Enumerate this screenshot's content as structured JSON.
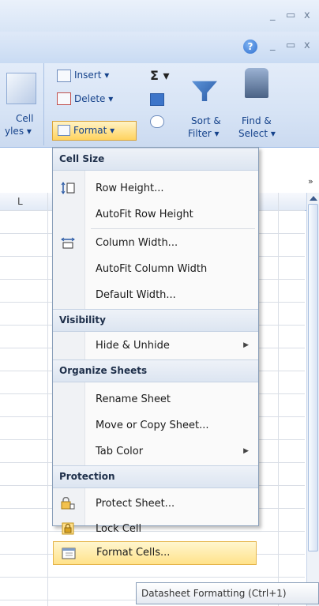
{
  "window_controls": {
    "minimize": "_",
    "restore": "▭",
    "close": "x"
  },
  "ribbon": {
    "help": "?",
    "styles_group": {
      "label_line1": "Cell",
      "label_line2": "yles ▾"
    },
    "cells_group": {
      "insert": "Insert ▾",
      "delete": "Delete ▾",
      "format": "Format ▾"
    },
    "editing_group": {
      "sum": "Σ ▾",
      "sort_filter": [
        "Sort &",
        "Filter ▾"
      ],
      "find_select": [
        "Find &",
        "Select ▾"
      ]
    }
  },
  "sheet": {
    "column_label": "L"
  },
  "menu": {
    "sections": [
      {
        "header": "Cell Size",
        "items": [
          {
            "label": "Row Height...",
            "icon": "row-height-icon",
            "submenu": false
          },
          {
            "label": "AutoFit Row Height",
            "icon": "",
            "submenu": false
          },
          {
            "label": "Column Width...",
            "icon": "column-width-icon",
            "submenu": false
          },
          {
            "label": "AutoFit Column Width",
            "icon": "",
            "submenu": false
          },
          {
            "label": "Default Width...",
            "icon": "",
            "submenu": false
          }
        ]
      },
      {
        "header": "Visibility",
        "items": [
          {
            "label": "Hide & Unhide",
            "icon": "",
            "submenu": true
          }
        ]
      },
      {
        "header": "Organize Sheets",
        "items": [
          {
            "label": "Rename Sheet",
            "icon": "",
            "submenu": false
          },
          {
            "label": "Move or Copy Sheet...",
            "icon": "",
            "submenu": false
          },
          {
            "label": "Tab Color",
            "icon": "",
            "submenu": true
          }
        ]
      },
      {
        "header": "Protection",
        "items": [
          {
            "label": "Protect Sheet...",
            "icon": "protect-sheet-icon",
            "submenu": false
          },
          {
            "label": "Lock Cell",
            "icon": "lock-icon",
            "submenu": false
          },
          {
            "label": "Format Cells...",
            "icon": "format-cells-icon",
            "submenu": false,
            "highlighted": true
          }
        ]
      }
    ]
  },
  "tooltip": "Datasheet Formatting (Ctrl+1)",
  "colors": {
    "highlight": "#ffe28a",
    "ribbon": "#d6e3f5",
    "header_text": "#15428b"
  }
}
